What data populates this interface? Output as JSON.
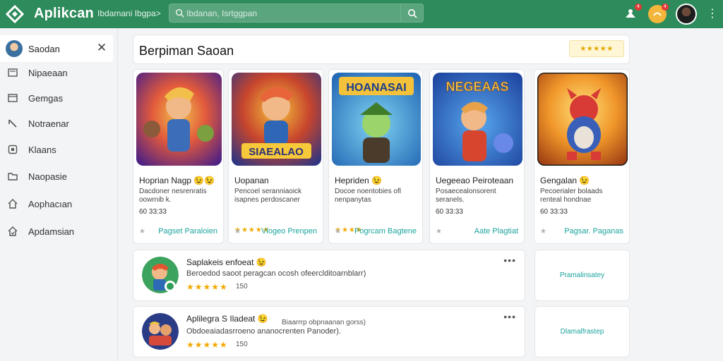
{
  "header": {
    "app_title": "Aplikcan",
    "app_subtitle": "Ibdamani Ibgpa>",
    "search_placeholder": "Ibdanan, Isrtggpan",
    "notif_badge": "4",
    "msg_badge": "4",
    "icons": [
      "logo-icon",
      "search-icon",
      "notification-icon",
      "messages-icon",
      "avatar",
      "kebab-icon"
    ],
    "colors": {
      "bar": "#2e8b5b",
      "accent": "#1ba39c",
      "stars": "#f2a900"
    }
  },
  "sidebar": {
    "user_name": "Saodan",
    "items": [
      {
        "label": "Nipaeaan",
        "icon": "image-icon"
      },
      {
        "label": "Gemgas",
        "icon": "window-icon"
      },
      {
        "label": "Notraenar",
        "icon": "wrench-icon"
      },
      {
        "label": "Klaans",
        "icon": "tag-icon"
      },
      {
        "label": "Naopasie",
        "icon": "folder-icon"
      },
      {
        "label": "Aophacıan",
        "icon": "house-icon"
      },
      {
        "label": "Apdamsian",
        "icon": "house-check-icon"
      }
    ]
  },
  "section": {
    "title": "Berpiman Saoan",
    "rating_chip": "★★★★★"
  },
  "cards": [
    {
      "title": "Hoprian Nagp 😉😉",
      "desc": "Dacdoner nesrenratis oowrnib k.",
      "meta": "60 33:33",
      "stars": "",
      "link": "Pagset Paraloien"
    },
    {
      "title": "Uopanan",
      "desc": "Pencoel seranniaoick isapnes perdoscaner",
      "meta": "",
      "stars": "★★★★★",
      "link": "Vlogeo Prenpen"
    },
    {
      "title": "Hepriden 😉",
      "desc": "Docoe noentobies ofl nenpanytas",
      "meta": "",
      "stars": "★★★★",
      "link": "Pogrcam Bagtene"
    },
    {
      "title": "Uegeeao Peiroteaan",
      "desc": "Posaecealonsorent seranels.",
      "meta": "60 33:33",
      "stars": "",
      "link": "Aate Plagtiat"
    },
    {
      "title": "Gengalan 😉",
      "desc": "Pecoerialer bolaads renteal hondnae",
      "meta": "60 33:33",
      "stars": "",
      "link": "Pagsar. Paganas"
    }
  ],
  "cards_art": [
    {
      "banner": "",
      "bg1": "#6a2fa6",
      "bg2": "#e25a3c",
      "hero": "#f1b34a"
    },
    {
      "banner": "SIAEALAO",
      "bg1": "#2d3a8f",
      "bg2": "#f2a51c",
      "hero": "#e8643a"
    },
    {
      "banner": "HOANASAI",
      "bg1": "#1c6bb5",
      "bg2": "#4bb8e8",
      "hero": "#4f9a3a"
    },
    {
      "banner": "NEGEAAS",
      "bg1": "#1f4aa8",
      "bg2": "#3c86e0",
      "hero": "#e2a24b"
    },
    {
      "banner": "",
      "bg1": "#e67a1e",
      "bg2": "#ffd24a",
      "hero": "#d83a35"
    }
  ],
  "rows": [
    {
      "title": "Saplakeis enfoeat 😉",
      "desc": "Beroedod saoot peragcan ocosh ofeerclditoarnblarr)",
      "stars": "★★★★★",
      "count": "150",
      "aside_link": "Pramalinsatey"
    },
    {
      "title": "Aplilegra  S Iladeat 😉",
      "desc": "Obdoeaiadasrroeno ananocrenten Panoder).",
      "note": "Biaarrrp obpnaanan gorss)",
      "stars": "★★★★★",
      "count": "150",
      "aside_link": "Dlamalfrastep"
    }
  ]
}
